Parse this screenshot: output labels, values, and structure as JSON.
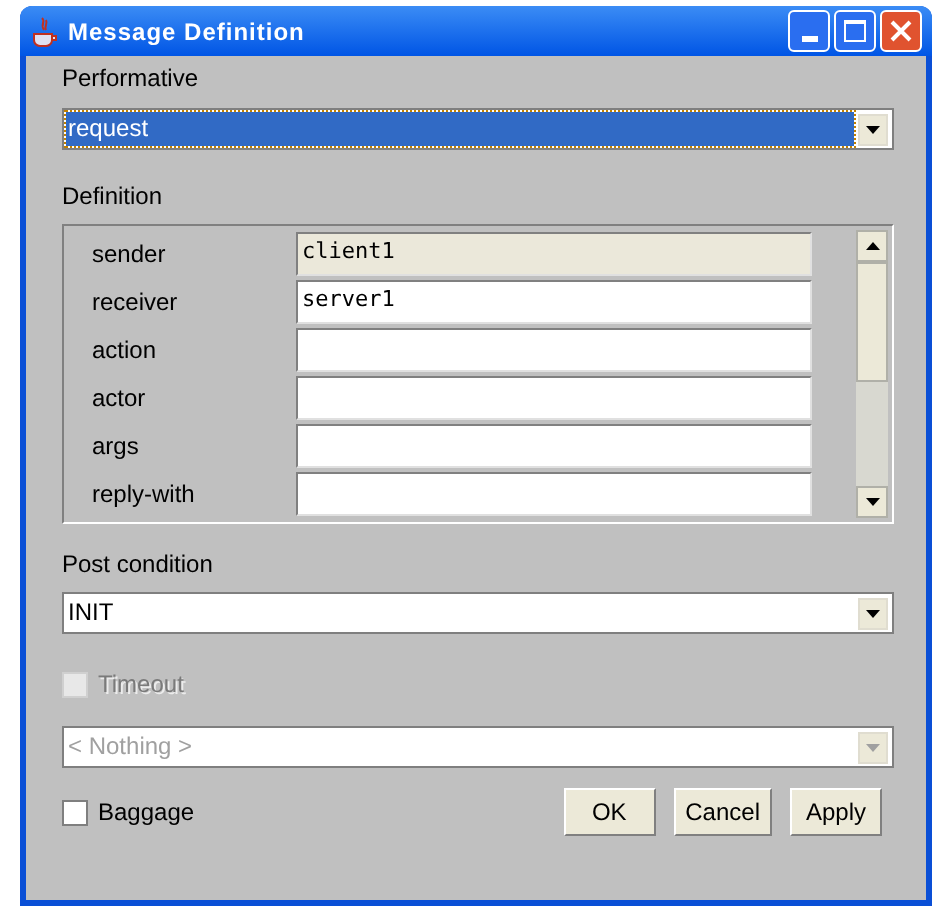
{
  "window": {
    "title": "Message Definition"
  },
  "performative": {
    "label": "Performative",
    "value": "request",
    "focused": true
  },
  "definition": {
    "label": "Definition",
    "rows": [
      {
        "name": "sender",
        "value": "client1",
        "editable": false
      },
      {
        "name": "receiver",
        "value": "server1",
        "editable": true
      },
      {
        "name": "action",
        "value": "",
        "editable": true
      },
      {
        "name": "actor",
        "value": "",
        "editable": true
      },
      {
        "name": "args",
        "value": "",
        "editable": true
      },
      {
        "name": "reply-with",
        "value": "",
        "editable": true
      }
    ]
  },
  "post_condition": {
    "label": "Post condition",
    "value": "INIT"
  },
  "timeout": {
    "label": "Timeout",
    "checked": false,
    "disabled": true
  },
  "timeout_select": {
    "value": "< Nothing >",
    "disabled": true
  },
  "baggage": {
    "label": "Baggage",
    "checked": false,
    "disabled": false
  },
  "buttons": [
    "OK",
    "Cancel",
    "Apply"
  ]
}
